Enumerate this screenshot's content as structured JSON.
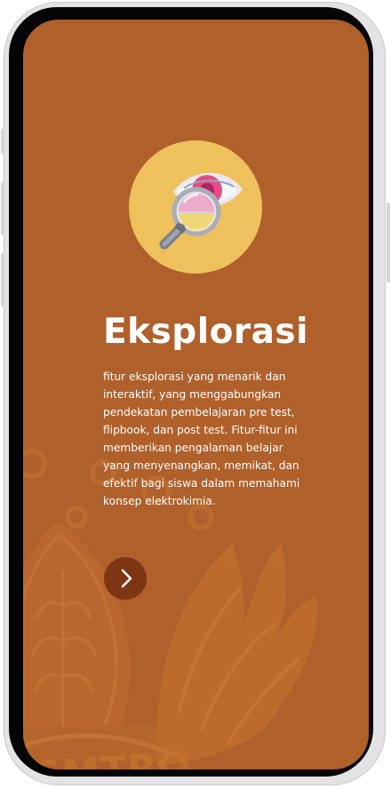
{
  "onboarding": {
    "title": "Eksplorasi",
    "description": "fitur eksplorasi yang menarik dan interaktif, yang menggabungkan pendekatan pembelajaran pre test, flipbook, dan post test. Fitur-fitur ini memberikan pengalaman belajar yang menyenangkan, memikat, dan efektif bagi siswa dalam memahami konsep elektrokimia.",
    "illustration": "magnifier-over-eye-icon",
    "next_icon": "chevron-right-icon",
    "watermark_text": "SMTRO"
  },
  "colors": {
    "screen_background": "#b0602b",
    "icon_circle": "#eec15d",
    "next_button": "#7d3513",
    "text": "#ffffff"
  }
}
